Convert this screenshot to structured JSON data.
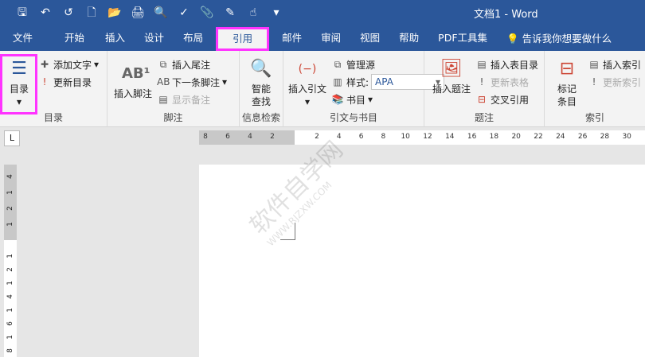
{
  "window": {
    "title": "文档1  -  Word"
  },
  "qat": [
    {
      "icon": "save-icon",
      "g": "🖫"
    },
    {
      "icon": "undo-icon",
      "g": "↶"
    },
    {
      "icon": "redo-icon",
      "g": "↺"
    },
    {
      "icon": "new-icon",
      "g": "🗋"
    },
    {
      "icon": "open-icon",
      "g": "📂"
    },
    {
      "icon": "print-icon",
      "g": "🖨"
    },
    {
      "icon": "print-preview-icon",
      "g": "🔍"
    },
    {
      "icon": "spelling-icon",
      "g": "✓"
    },
    {
      "icon": "attach-icon",
      "g": "📎"
    },
    {
      "icon": "edit-icon",
      "g": "✎"
    },
    {
      "icon": "touch-mode-icon",
      "g": "☝"
    },
    {
      "icon": "customize-icon",
      "g": "▾"
    }
  ],
  "tabs": [
    "文件",
    "开始",
    "插入",
    "设计",
    "布局",
    "引用",
    "邮件",
    "审阅",
    "视图",
    "帮助",
    "PDF工具集"
  ],
  "active_tab": "引用",
  "tell_me": "告诉我你想要做什么",
  "ribbon": {
    "toc": {
      "label": "目录",
      "toc_button": "目录",
      "add_text": "添加文字",
      "update_toc": "更新目录"
    },
    "footnotes": {
      "label": "脚注",
      "insert_footnote": "插入脚注",
      "insert_endnote": "插入尾注",
      "next_footnote": "下一条脚注",
      "show_notes": "显示备注"
    },
    "research": {
      "label": "信息检索",
      "smart_lookup": "智能查找"
    },
    "citations": {
      "label": "引文与书目",
      "insert_citation": "插入引文",
      "manage_sources": "管理源",
      "style_label": "样式:",
      "style_value": "APA",
      "bibliography": "书目"
    },
    "captions": {
      "label": "题注",
      "insert_caption": "插入题注",
      "insert_table_of_figures": "插入表目录",
      "update_table": "更新表格",
      "cross_reference": "交叉引用"
    },
    "index": {
      "label": "索引",
      "mark_entry": "标记条目",
      "insert_index": "插入索引",
      "update_index": "更新索引"
    }
  },
  "ruler": {
    "tab_selector": "L",
    "h_ticks": [
      "8",
      "6",
      "4",
      "2",
      "2",
      "4",
      "6",
      "8",
      "10",
      "12",
      "14",
      "16",
      "18",
      "20",
      "22",
      "24",
      "26",
      "28",
      "30"
    ],
    "v_ticks": [
      "4",
      "1",
      "2",
      "1",
      "1",
      "2",
      "1",
      "4",
      "1",
      "6",
      "1",
      "8"
    ]
  },
  "watermark": {
    "text": "软件自学网",
    "url": "WWW.RJZXW.COM"
  }
}
